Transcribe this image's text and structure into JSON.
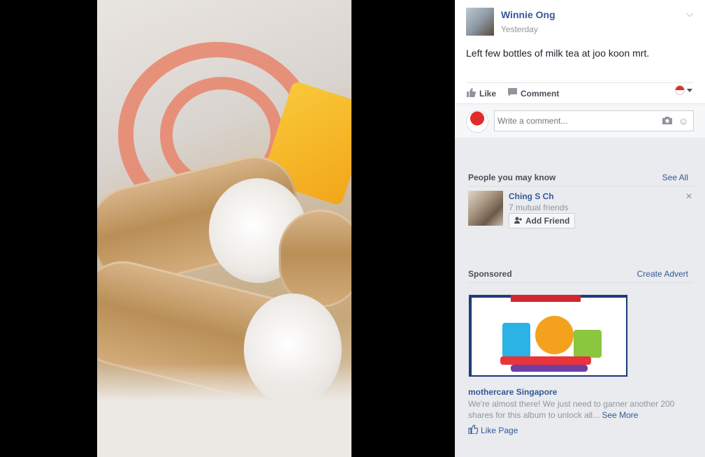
{
  "post": {
    "author": "Winnie Ong",
    "time": "Yesterday",
    "message": "Left few bottles of milk tea at joo koon mrt.",
    "like_label": "Like",
    "comment_label": "Comment",
    "comment_placeholder": "Write a comment..."
  },
  "people": {
    "title": "People you may know",
    "see_all": "See All",
    "suggestion": {
      "name": "Ching S Ch",
      "mutual": "7 mutual friends",
      "add_label": "Add Friend"
    }
  },
  "sponsored": {
    "title": "Sponsored",
    "create_advert": "Create Advert",
    "ad": {
      "advertiser": "mothercare Singapore",
      "description": "We're almost there! We just need to garner another 200 shares for this album to unlock all...",
      "see_more": "See More",
      "like_page": "Like Page"
    }
  },
  "colors": {
    "link": "#365899",
    "panel_bg": "#e9ebee"
  }
}
